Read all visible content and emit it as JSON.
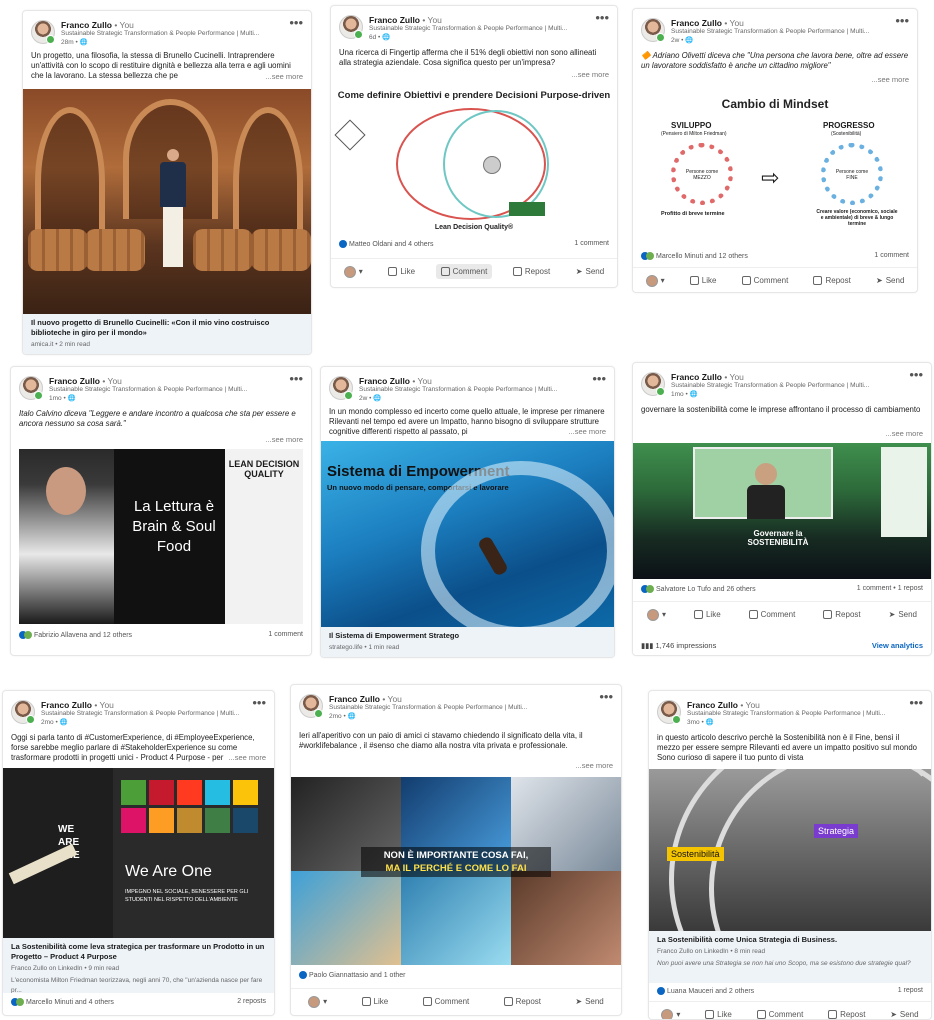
{
  "author": {
    "name": "Franco Zullo",
    "you": "• You",
    "subtitle": "Sustainable Strategic Transformation & People Performance | Multi..."
  },
  "actions": {
    "like": "Like",
    "comment": "Comment",
    "repost": "Repost",
    "send": "Send",
    "see_more": "...see more"
  },
  "posts": [
    {
      "time": "28m • 🌐",
      "text": "Un progetto, una filosofia, la stessa di Brunello Cucinelli. Intraprendere un'attività con lo scopo di restituire dignità e bellezza alla terra e agli uomini che la lavorano. La stessa bellezza che pe",
      "caption": "Il nuovo progetto di Brunello Cucinelli: «Con il mio vino costruisco biblioteche in giro per il mondo»",
      "caption_meta": "amica.it • 2 min read"
    },
    {
      "time": "6d • 🌐",
      "text": "Una ricerca di Fingertip afferma che il 51% degli obiettivi non sono allineati alla strategia aziendale. Cosa significa questo per un'impresa?",
      "diagram_title": "Come definire Obiettivi e prendere Decisioni Purpose-driven",
      "diagram_footer": "Lean Decision Quality®",
      "reactions": "Matteo Oldani and 4 others",
      "comments": "1 comment"
    },
    {
      "time": "2w • 🌐",
      "text": "🔶 Adriano Olivetti diceva che \"Una persona che lavora bene, oltre ad essere un lavoratore soddisfatto è anche un cittadino migliore\"",
      "title": "Cambio di Mindset",
      "left_label": "SVILUPPO",
      "left_sub": "(Pensiero di Milton Friedman)",
      "left_center": "Persone come MEZZO",
      "left_foot": "Profitto di breve termine",
      "right_label": "PROGRESSO",
      "right_sub": "(Sostenibilità)",
      "right_center": "Persone come FINE",
      "right_foot": "Creare valore (economico, sociale e ambientale) di breve & lungo termine",
      "reactions": "Marcello Minuti and 12 others",
      "comments": "1 comment"
    },
    {
      "time": "1mo • 🌐",
      "text": "Italo Calvino diceva \"Leggere e andare incontro a qualcosa che sta per essere e ancora nessuno sa cosa sarà.\"",
      "img_text": "La Lettura è Brain & Soul Food",
      "book": "LEAN DECISION QUALITY",
      "reactions": "Fabrizio Allavena and 12 others",
      "comments": "1 comment"
    },
    {
      "time": "2w • 🌐",
      "text": "In un mondo complesso ed incerto come quello attuale, le imprese per rimanere Rilevanti nel tempo ed avere un Impatto, hanno bisogno di sviluppare strutture cognitive differenti rispetto al passato, pi",
      "img_title": "Sistema di Empowerment",
      "img_sub": "Un nuovo modo di pensare, comportarsi e lavorare",
      "caption": "Il Sistema di Empowerment Stratego",
      "caption_meta": "stratego.life • 1 min read"
    },
    {
      "time": "1mo • 🌐",
      "text": "governare la sostenibilità come le imprese affrontano il processo di cambiamento",
      "banner": "Governare la SOSTENIBILITÀ",
      "reactions": "Salvatore Lo Tufo and 26 others",
      "comments": "1 comment • 1 repost",
      "impressions": "1,746 impressions",
      "analytics": "View analytics"
    },
    {
      "time": "2mo • 🌐",
      "text": "Oggi si parla tanto di #CustomerExperience, di #EmployeeExperience, forse sarebbe meglio parlare di #StakeholderExperience su come trasformare prodotti in progetti unici - Product 4 Purpose - per prosperare",
      "img_title": "We Are One",
      "img_sub": "IMPEGNO NEL SOCIALE, BENESSERE PER GLI STUDENTI NEL RISPETTO DELL'AMBIENTE",
      "wall_text": "WE ARE ONE",
      "caption": "La Sostenibilità come leva strategica per trasformare un Prodotto in un Progetto – Product 4 Purpose",
      "caption_meta": "Franco Zullo on LinkedIn • 9 min read",
      "excerpt": "L'economista Milton Friedman teorizzava, negli anni 70, che \"un'azienda nasce per fare pr...",
      "reactions": "Marcello Minuti and 4 others",
      "comments": "2 reposts"
    },
    {
      "time": "2mo • 🌐",
      "text": "Ieri all'aperitivo con un paio di amici ci stavamo chiedendo il significato della vita, il #worklifebalance , il #senso che diamo alla nostra vita privata e professionale.",
      "overlay_1": "NON È IMPORTANTE COSA FAI,",
      "overlay_2": "MA IL PERCHÉ E COME LO FAI",
      "reactions": "Paolo Giannattasio and 1 other"
    },
    {
      "time": "3mo • 🌐",
      "text": "in questo articolo descrivo perchè la Sostenibilità non è il Fine, bensì il mezzo per essere sempre Rilevanti ed avere un impatto positivo sul mondo Sono curioso di sapere il tuo punto di vista",
      "tag_1": "Sostenibilità",
      "tag_2": "Strategia",
      "caption": "La Sostenibilità come Unica Strategia di Business.",
      "caption_meta": "Franco Zullo on LinkedIn • 8 min read",
      "excerpt": "Non puoi avere una Strategia se non hai uno Scopo, ma se esistono due strategie qual?",
      "reactions": "Luana Mauceri and 2 others",
      "comments": "1 repost"
    }
  ]
}
